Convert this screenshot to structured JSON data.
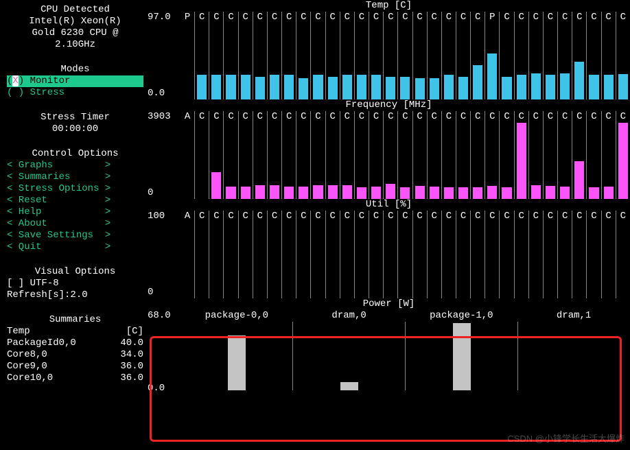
{
  "sidebar": {
    "cpu_detected_title": "CPU Detected",
    "cpu_line1": "Intel(R) Xeon(R)",
    "cpu_line2": "Gold 6230 CPU @",
    "cpu_line3": "2.10GHz",
    "modes_title": "Modes",
    "mode_monitor": "(X) Monitor",
    "mode_stress": "( ) Stress",
    "stress_timer_title": "Stress Timer",
    "stress_timer_value": "00:00:00",
    "control_options_title": "Control Options",
    "control_options": [
      "< Graphs         >",
      "< Summaries      >",
      "< Stress Options >",
      "< Reset          >",
      "< Help           >",
      "< About          >",
      "< Save Settings  >",
      "< Quit           >"
    ],
    "visual_options_title": "Visual Options",
    "utf8_option": "[ ] UTF-8",
    "refresh_option": "Refresh[s]:2.0",
    "summaries_title": "Summaries",
    "summaries": [
      {
        "label": "Temp",
        "value": "[C]"
      },
      {
        "label": "PackageId0,0",
        "value": "40.0"
      },
      {
        "label": "Core8,0",
        "value": "34.0"
      },
      {
        "label": "Core9,0",
        "value": "36.0"
      },
      {
        "label": "Core10,0",
        "value": "36.0"
      }
    ]
  },
  "chart_data": [
    {
      "type": "bar",
      "title": "Temp [C]",
      "ylim": [
        0.0,
        97.0
      ],
      "y_top": "97.0",
      "y_bottom": "0.0",
      "categories": [
        "P",
        "C",
        "C",
        "C",
        "C",
        "C",
        "C",
        "C",
        "C",
        "C",
        "C",
        "C",
        "C",
        "C",
        "C",
        "C",
        "C",
        "C",
        "C",
        "C",
        "C",
        "P",
        "C",
        "C",
        "C",
        "C",
        "C",
        "C",
        "C",
        "C",
        "C"
      ],
      "values": [
        0,
        32,
        32,
        32,
        32,
        30,
        32,
        32,
        28,
        32,
        30,
        32,
        32,
        32,
        30,
        30,
        28,
        28,
        32,
        30,
        45,
        60,
        30,
        32,
        34,
        32,
        34,
        50,
        32,
        32,
        33
      ],
      "color": "cyan"
    },
    {
      "type": "bar",
      "title": "Frequency [MHz]",
      "ylim": [
        0,
        3903
      ],
      "y_top": "3903",
      "y_bottom": "0",
      "categories": [
        "A",
        "C",
        "C",
        "C",
        "C",
        "C",
        "C",
        "C",
        "C",
        "C",
        "C",
        "C",
        "C",
        "C",
        "C",
        "C",
        "C",
        "C",
        "C",
        "C",
        "C",
        "C",
        "C",
        "C",
        "C",
        "C",
        "C",
        "C",
        "C",
        "C",
        "C"
      ],
      "values": [
        0,
        0,
        35,
        16,
        16,
        18,
        18,
        16,
        16,
        18,
        18,
        18,
        15,
        16,
        20,
        15,
        17,
        16,
        15,
        15,
        15,
        17,
        15,
        100,
        18,
        17,
        16,
        50,
        15,
        16,
        100
      ],
      "color": "magenta"
    },
    {
      "type": "bar",
      "title": "Util [%]",
      "ylim": [
        0,
        100
      ],
      "y_top": "100",
      "y_bottom": "0",
      "categories": [
        "A",
        "C",
        "C",
        "C",
        "C",
        "C",
        "C",
        "C",
        "C",
        "C",
        "C",
        "C",
        "C",
        "C",
        "C",
        "C",
        "C",
        "C",
        "C",
        "C",
        "C",
        "C",
        "C",
        "C",
        "C",
        "C",
        "C",
        "C",
        "C",
        "C",
        "C"
      ],
      "values": [
        0,
        0,
        0,
        0,
        0,
        0,
        0,
        0,
        0,
        0,
        0,
        0,
        0,
        0,
        0,
        0,
        0,
        0,
        0,
        0,
        0,
        0,
        0,
        0,
        0,
        0,
        0,
        0,
        0,
        0,
        0
      ],
      "color": "grey"
    },
    {
      "type": "bar",
      "title": "Power [W]",
      "ylim": [
        0.0,
        68.0
      ],
      "y_top": "68.0",
      "y_bottom": "0.0",
      "categories": [
        "package-0,0",
        "dram,0",
        "package-1,0",
        "dram,1"
      ],
      "values": [
        80,
        12,
        98,
        0
      ],
      "color": "grey"
    }
  ],
  "watermark": "CSDN @小锋学长生活大爆炸"
}
